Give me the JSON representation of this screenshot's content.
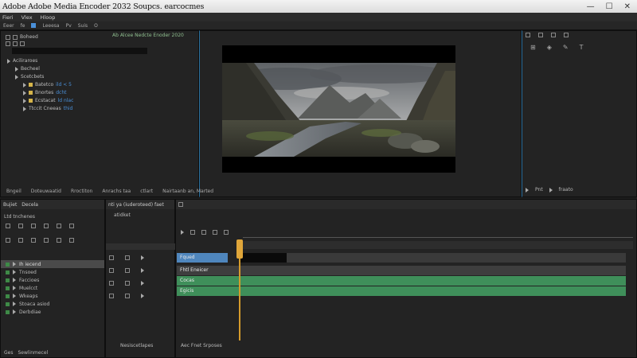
{
  "window": {
    "title": "Adobe Adobe Media Encoder 2032 Soupcs. earcocmes"
  },
  "menu": [
    "Fieri",
    "Vlex",
    "Hloop"
  ],
  "toolbar": [
    "Eeer",
    "fe",
    "Leeesa",
    "Pv",
    "Suis",
    "O"
  ],
  "project": {
    "tab_label": "Boheed",
    "tree": [
      {
        "label": "Aciliraroes",
        "level": 0,
        "color": ""
      },
      {
        "label": "Becheel",
        "level": 1,
        "color": ""
      },
      {
        "label": "Scetcbets",
        "level": 1,
        "color": ""
      },
      {
        "label": "Batetco",
        "level": 2,
        "color": "#d6b54a",
        "tag": "ild < 5"
      },
      {
        "label": "Bnortes",
        "level": 2,
        "color": "#d6b54a",
        "tag": "dcht"
      },
      {
        "label": "Ecstacat",
        "level": 2,
        "color": "#d6b54a",
        "tag": "ld nlac"
      },
      {
        "label": "Ttccit Cneeas",
        "level": 2,
        "color": "",
        "tag": "thid"
      }
    ]
  },
  "program": {
    "title": "Ab Alcee Nedcte Enoder 2020"
  },
  "monitor_footer": [
    "Bngeil",
    "Doteuwaatid",
    "Rroctiton",
    "Anrachs taa",
    "ctlart",
    "Nairtaanb an, Marted"
  ],
  "right_panel": {
    "footer_items": [
      "Pnt",
      "fraato"
    ]
  },
  "layers_panel": {
    "tab": "Bujiet",
    "tab2": "Decela",
    "subtitle": "Ltd tnchenes",
    "items": [
      {
        "label": "Ih iecend",
        "selected": true
      },
      {
        "label": "Tnsoed",
        "selected": false
      },
      {
        "label": "Faccioes",
        "selected": false
      },
      {
        "label": "Muelcct",
        "selected": false
      },
      {
        "label": "Wkeaps",
        "selected": false
      },
      {
        "label": "Stoaca asiod",
        "selected": false
      },
      {
        "label": "Derbdiae",
        "selected": false
      }
    ],
    "footer": [
      "Ges",
      "Sewlinmecel"
    ]
  },
  "mid_panel": {
    "tab": "nti ya (iuderoteed) faet",
    "subtitle": "atidket",
    "footer": "Nesiscetlapes"
  },
  "timeline": {
    "tracks": [
      {
        "label": "Fqued",
        "color": "#4f86bd",
        "type": "label"
      },
      {
        "label": "Fhtl Eneicer",
        "color": "#3e3e3e",
        "type": "dark"
      },
      {
        "label": "Cocas",
        "color": "#3f8f5a",
        "type": "audio"
      },
      {
        "label": "Egicis",
        "color": "#3f8f5a",
        "type": "audio"
      }
    ],
    "footer": "Aec Fnet Srposes"
  }
}
